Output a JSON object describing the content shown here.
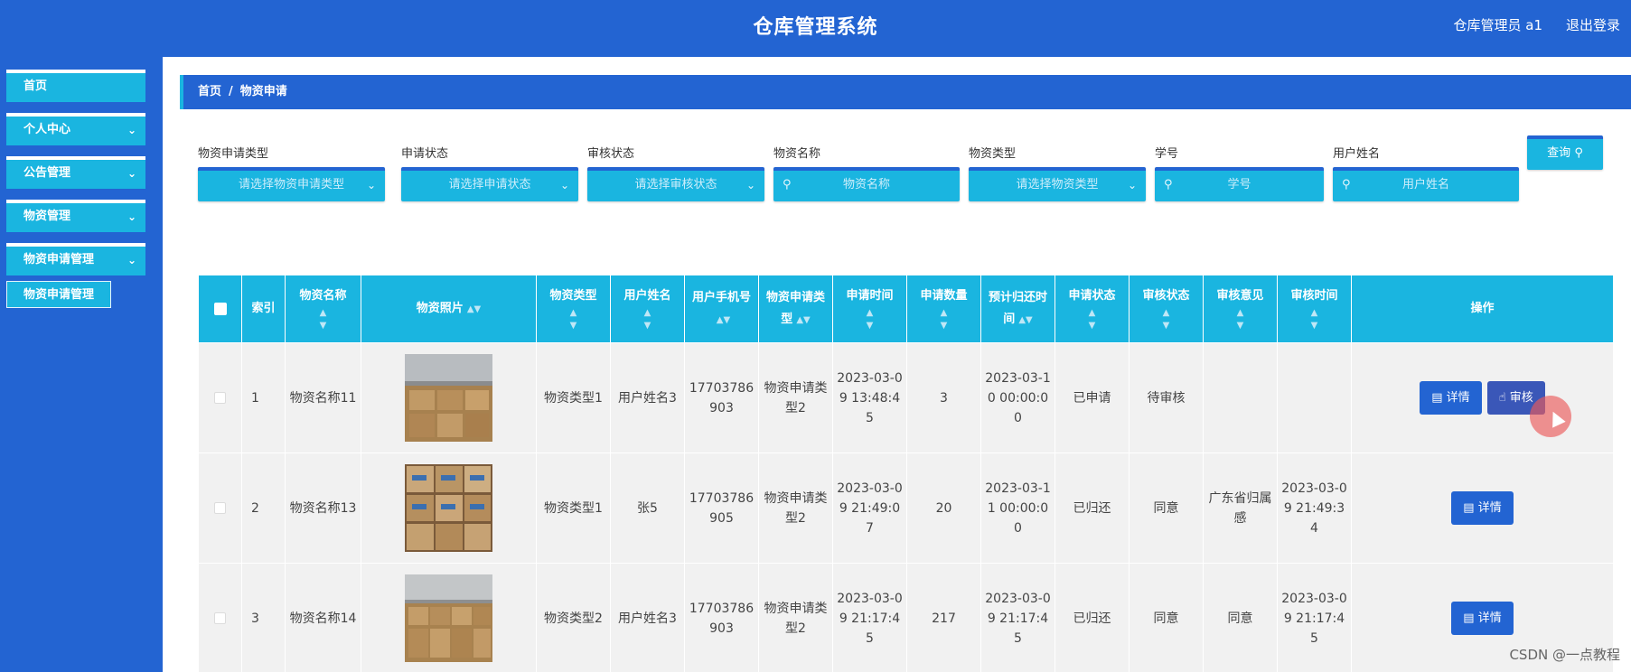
{
  "header": {
    "title": "仓库管理系统",
    "user": "仓库管理员 a1",
    "logout": "退出登录"
  },
  "sidebar": {
    "items": [
      {
        "label": "首页"
      },
      {
        "label": "个人中心",
        "chevron": "chevron-down-icon"
      },
      {
        "label": "公告管理",
        "chevron": "chevron-down-icon"
      },
      {
        "label": "物资管理",
        "chevron": "chevron-down-icon"
      },
      {
        "label": "物资申请管理",
        "chevron": "chevron-down-icon"
      }
    ],
    "submenu": {
      "label": "物资申请管理"
    }
  },
  "breadcrumb": {
    "home": "首页",
    "separator": "/",
    "current": "物资申请"
  },
  "filters": {
    "apply_type": {
      "label": "物资申请类型",
      "placeholder": "请选择物资申请类型"
    },
    "apply_status": {
      "label": "申请状态",
      "placeholder": "请选择申请状态"
    },
    "review_status": {
      "label": "审核状态",
      "placeholder": "请选择审核状态"
    },
    "material_name": {
      "label": "物资名称",
      "placeholder": "物资名称"
    },
    "material_type": {
      "label": "物资类型",
      "placeholder": "请选择物资类型"
    },
    "student_id": {
      "label": "学号",
      "placeholder": "学号"
    },
    "user_name": {
      "label": "用户姓名",
      "placeholder": "用户姓名"
    },
    "query_button": "查询"
  },
  "table": {
    "columns": [
      "索引",
      "物资名称",
      "物资照片",
      "物资类型",
      "用户姓名",
      "用户手机号",
      "物资申请类型",
      "申请时间",
      "申请数量",
      "预计归还时间",
      "申请状态",
      "审核状态",
      "审核意见",
      "审核时间",
      "操作"
    ],
    "rows": [
      {
        "index": "1",
        "name": "物资名称11",
        "type": "物资类型1",
        "user": "用户姓名3",
        "phone": "17703786903",
        "apply_type": "物资申请类型2",
        "apply_time": "2023-03-09 13:48:45",
        "quantity": "3",
        "return_time": "2023-03-10 00:00:00",
        "apply_status": "已申请",
        "review_status": "待审核",
        "review_opinion": "",
        "review_time": ""
      },
      {
        "index": "2",
        "name": "物资名称13",
        "type": "物资类型1",
        "user": "张5",
        "phone": "17703786905",
        "apply_type": "物资申请类型2",
        "apply_time": "2023-03-09 21:49:07",
        "quantity": "20",
        "return_time": "2023-03-11 00:00:00",
        "apply_status": "已归还",
        "review_status": "同意",
        "review_opinion": "广东省归属感",
        "review_time": "2023-03-09 21:49:34"
      },
      {
        "index": "3",
        "name": "物资名称14",
        "type": "物资类型2",
        "user": "用户姓名3",
        "phone": "17703786903",
        "apply_type": "物资申请类型2",
        "apply_time": "2023-03-09 21:17:45",
        "quantity": "217",
        "return_time": "2023-03-09 21:17:45",
        "apply_status": "已归还",
        "review_status": "同意",
        "review_opinion": "同意",
        "review_time": "2023-03-09 21:17:45"
      }
    ],
    "actions": {
      "detail": "详情",
      "review": "审核"
    }
  },
  "icons": {
    "dropdown": "chevron-down-icon",
    "search": "search-icon",
    "detail": "document-icon",
    "review": "thumb-up-icon",
    "sort": "sort-icon"
  },
  "colors": {
    "primary": "#2364d2",
    "accent": "#1ab5e0",
    "review_button": "#3a57b8"
  },
  "watermark": "CSDN @一点教程"
}
